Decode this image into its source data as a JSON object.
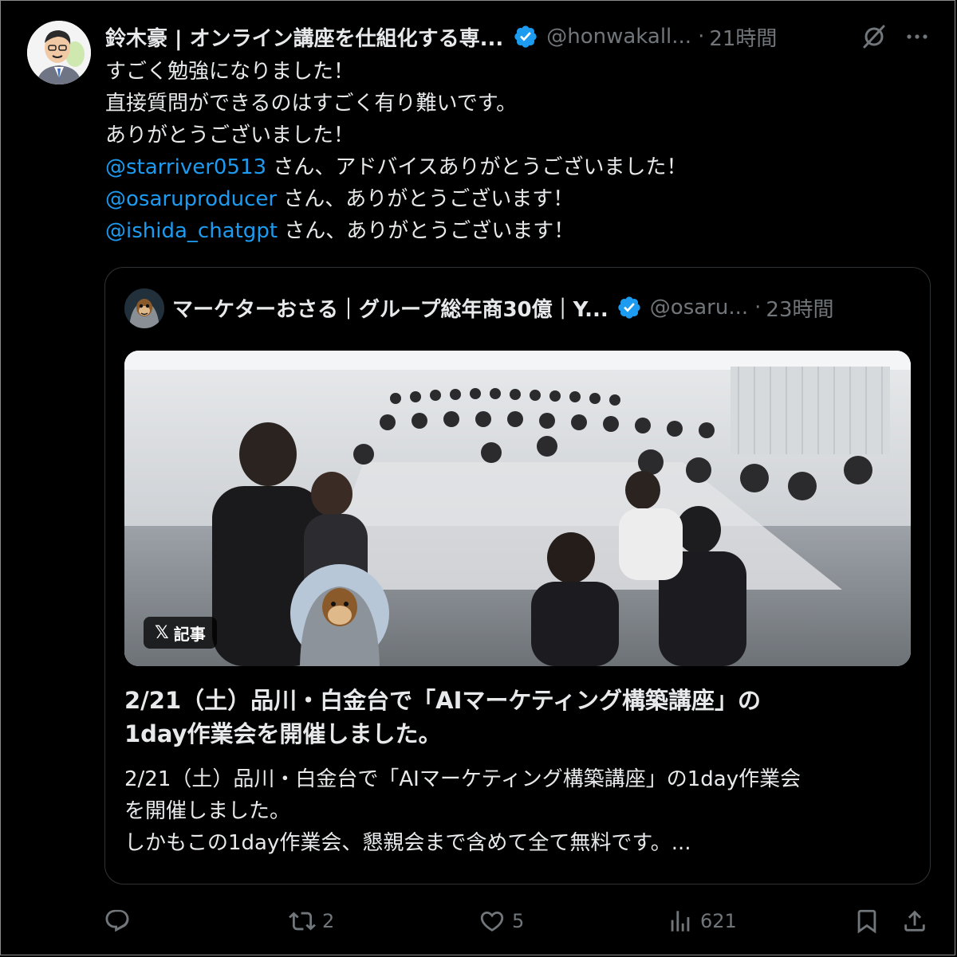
{
  "tweet": {
    "author_name": "鈴木豪 | オンライン講座を仕組化する専...",
    "handle": "@honwakall...",
    "separator": "·",
    "time": "21時間",
    "lines": [
      {
        "text": "すごく勉強になりました！"
      },
      {
        "text": "直接質問ができるのはすごく有り難いです。"
      },
      {
        "text": "ありがとうございました！"
      },
      {
        "mention": "@starriver0513",
        "text": " さん、アドバイスありがとうございました！"
      },
      {
        "mention": "@osaruproducer",
        "text": " さん、ありがとうございます！"
      },
      {
        "mention": "@ishida_chatgpt",
        "text": " さん、ありがとうございます！"
      }
    ]
  },
  "quote": {
    "author_name": "マーケターおさる｜グループ総年商30億｜Y...",
    "handle": "@osaru...",
    "separator": "·",
    "time": "23時間",
    "badge_label": "記事",
    "badge_x": "𝕏",
    "title_line1": "2/21（土）品川・白金台で「AIマーケティング構築講座」の",
    "title_line2": "1day作業会を開催しました。",
    "summary_line1": "2/21（土）品川・白金台で「AIマーケティング構築講座」の1day作業会",
    "summary_line2": "を開催しました。",
    "summary_line3": "しかもこの1day作業会、懇親会まで含めて全て無料です。..."
  },
  "actions": {
    "reply_count": "",
    "retweet_count": "2",
    "like_count": "5",
    "views_count": "621"
  },
  "colors": {
    "background": "#000000",
    "text": "#e7e9ea",
    "muted": "#71767b",
    "link": "#1d9bf0",
    "border": "#2f3336",
    "verified": "#1d9bf0"
  }
}
